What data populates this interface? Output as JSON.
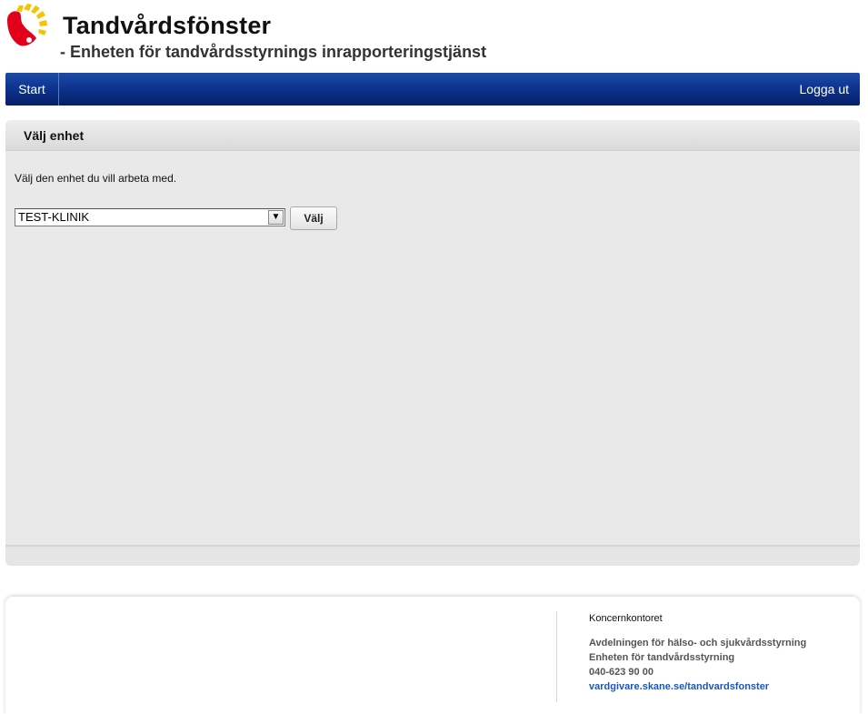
{
  "header": {
    "title": "Tandvårdsfönster",
    "subtitle": "- Enheten för tandvårdsstyrnings inrapporteringstjänst",
    "logo_icon": "region-skane-logo"
  },
  "nav": {
    "start_label": "Start",
    "logout_label": "Logga ut"
  },
  "panel": {
    "heading": "Välj enhet",
    "instruction": "Välj den enhet du vill arbeta med.",
    "unit_select": {
      "selected": "TEST-KLINIK",
      "arrow": "▼"
    },
    "choose_button_label": "Välj"
  },
  "footer": {
    "org_name": "Koncernkontoret",
    "department": "Avdelningen för hälso- och sjukvårdsstyrning",
    "unit": "Enheten för tandvårdsstyrning",
    "phone": "040-623 90 00",
    "link_text": "vardgivare.skane.se/tandvardsfonster"
  },
  "colors": {
    "nav_blue": "#0d3590",
    "panel_bg": "#e9e9e9",
    "link": "#1a56c4",
    "logo_yellow": "#f5c400",
    "logo_red": "#e2001a"
  }
}
